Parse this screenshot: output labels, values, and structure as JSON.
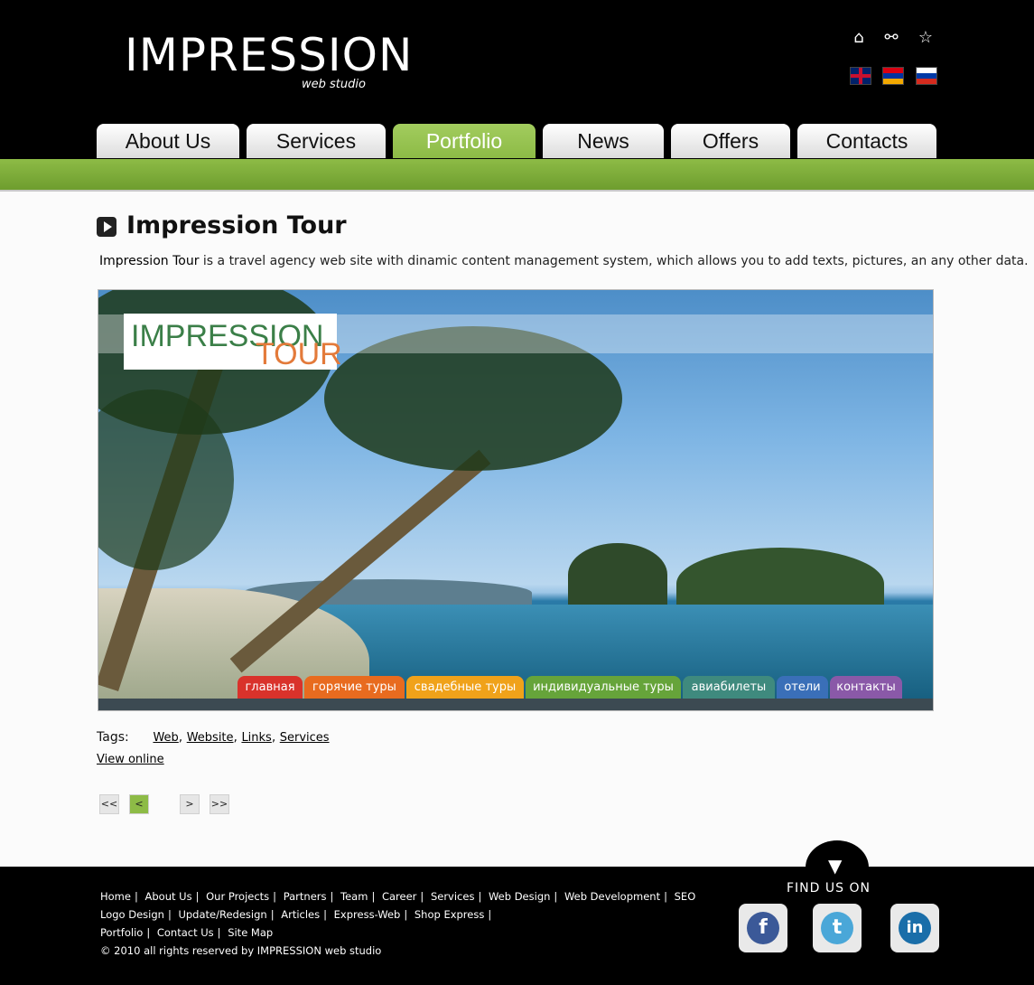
{
  "header": {
    "logo_main": "IMPRESSION",
    "logo_sub": "web studio",
    "icons": [
      "home-icon",
      "sitemap-icon",
      "favorite-icon"
    ],
    "flags": [
      "uk-flag",
      "armenia-flag",
      "russia-flag"
    ]
  },
  "nav": {
    "tabs": [
      {
        "label": "About Us"
      },
      {
        "label": "Services"
      },
      {
        "label": "Portfolio",
        "active": true
      },
      {
        "label": "News"
      },
      {
        "label": "Offers"
      },
      {
        "label": "Contacts"
      }
    ]
  },
  "content": {
    "title": "Impression Tour",
    "intro_strong": "Impression Tour",
    "intro_rest": " is a travel agency web site with dinamic content management system, which allows you to add texts, pictures, an any other data.",
    "screenshot": {
      "logo_line1": "IMPRESSION",
      "logo_line2": "TOUR",
      "menu": [
        {
          "label": "главная",
          "color": "#d9322b"
        },
        {
          "label": "горячие туры",
          "color": "#e86b1f"
        },
        {
          "label": "свадебные туры",
          "color": "#f0a21a"
        },
        {
          "label": "индивидуальные туры",
          "color": "#66a43a"
        },
        {
          "label": "авиабилеты",
          "color": "#3f8a7e"
        },
        {
          "label": "отели",
          "color": "#3a6fb8"
        },
        {
          "label": "контакты",
          "color": "#8a59a8"
        }
      ]
    },
    "tags_label": "Tags:",
    "tags": [
      "Web",
      "Website",
      "Links",
      "Services"
    ],
    "view_online": "View online",
    "pager": {
      "first": "<<",
      "prev": "<",
      "next": ">",
      "last": ">>"
    }
  },
  "footer": {
    "links_row1": [
      "Home",
      "About Us",
      "Our Projects",
      "Partners",
      "Team",
      "Career",
      "Services",
      "Web Design",
      "Web Development",
      "SEO"
    ],
    "links_row2": [
      "Logo Design",
      "Update/Redesign",
      "Articles",
      "Express-Web",
      "Shop Express"
    ],
    "links_row3": [
      "Portfolio",
      "Contact Us",
      "Site Map"
    ],
    "copyright": "© 2010 all rights reserved by IMPRESSION web studio",
    "find_us": "FIND US ON",
    "social": [
      {
        "name": "facebook",
        "glyph": "f",
        "color": "#3b5998"
      },
      {
        "name": "twitter",
        "glyph": "t",
        "color": "#4aa7d8"
      },
      {
        "name": "linkedin",
        "glyph": "in",
        "color": "#1a6ea9"
      }
    ]
  }
}
